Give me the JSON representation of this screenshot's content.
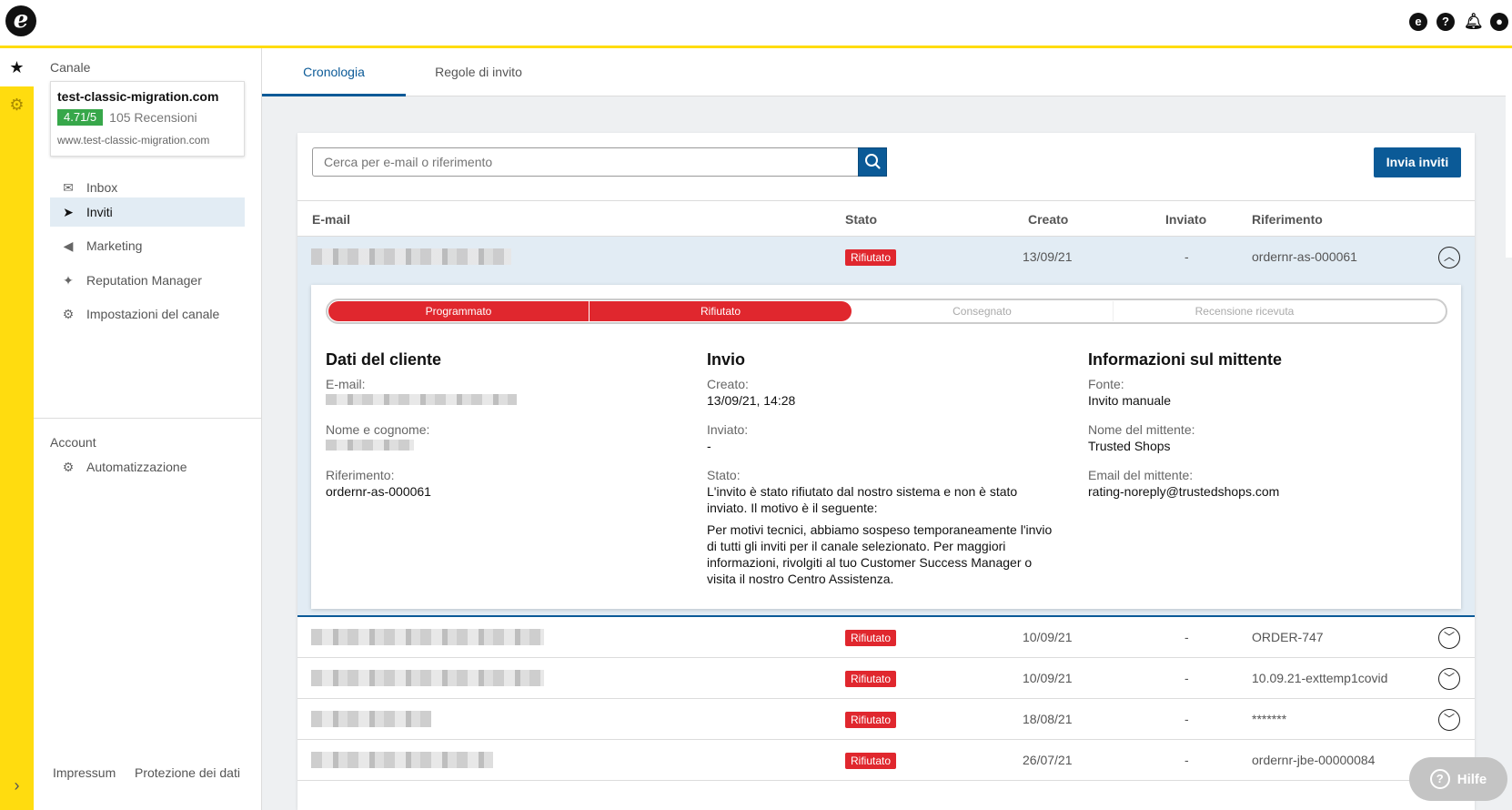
{
  "topbar": {
    "logo_glyph": "e",
    "icons": [
      "etrusted-icon",
      "help-icon",
      "bell-icon",
      "user-icon"
    ]
  },
  "rail": {
    "star": "★",
    "gear": "⚙",
    "chevron": "›"
  },
  "sidebar": {
    "channel_label": "Canale",
    "channel": {
      "name": "test-classic-migration.com",
      "rating": "4.71/5",
      "reviews": "105 Recensioni",
      "url": "www.test-classic-migration.com"
    },
    "items": [
      {
        "label": "Inbox",
        "icon": "inbox-icon",
        "glyph": "✉",
        "active": false
      },
      {
        "label": "Inviti",
        "icon": "paper-plane-icon",
        "glyph": "➤",
        "active": true
      },
      {
        "label": "Marketing",
        "icon": "megaphone-icon",
        "glyph": "◀",
        "active": false
      },
      {
        "label": "Reputation Manager",
        "icon": "sparkle-icon",
        "glyph": "✦",
        "active": false
      },
      {
        "label": "Impostazioni del canale",
        "icon": "gear-icon",
        "glyph": "⚙",
        "active": false
      }
    ],
    "account_label": "Account",
    "account_items": [
      {
        "label": "Automatizzazione",
        "icon": "automation-icon",
        "glyph": "⚙"
      }
    ],
    "footer": {
      "impressum": "Impressum",
      "privacy": "Protezione dei dati"
    }
  },
  "tabs": [
    {
      "label": "Cronologia",
      "active": true
    },
    {
      "label": "Regole di invito",
      "active": false
    }
  ],
  "search": {
    "placeholder": "Cerca per e-mail o riferimento"
  },
  "send_button": "Invia inviti",
  "table": {
    "headers": {
      "email": "E-mail",
      "stato": "Stato",
      "creato": "Creato",
      "inviato": "Inviato",
      "riferimento": "Riferimento"
    },
    "rows": [
      {
        "status": "Rifiutato",
        "created": "13/09/21",
        "sent": "-",
        "ref": "ordernr-as-000061",
        "expanded": true
      },
      {
        "status": "Rifiutato",
        "created": "10/09/21",
        "sent": "-",
        "ref": "ORDER-747",
        "expanded": false
      },
      {
        "status": "Rifiutato",
        "created": "10/09/21",
        "sent": "-",
        "ref": "10.09.21-exttemp1covid",
        "expanded": false
      },
      {
        "status": "Rifiutato",
        "created": "18/08/21",
        "sent": "-",
        "ref": "*******",
        "expanded": false
      },
      {
        "status": "Rifiutato",
        "created": "26/07/21",
        "sent": "-",
        "ref": "ordernr-jbe-00000084",
        "expanded": false
      }
    ]
  },
  "detail": {
    "steps": [
      {
        "label": "Programmato",
        "done": true
      },
      {
        "label": "Rifiutato",
        "done": true
      },
      {
        "label": "Consegnato",
        "done": false
      },
      {
        "label": "Recensione ricevuta",
        "done": false
      }
    ],
    "customer": {
      "title": "Dati del cliente",
      "email_label": "E-mail:",
      "name_label": "Nome e cognome:",
      "ref_label": "Riferimento:",
      "ref_value": "ordernr-as-000061"
    },
    "invio": {
      "title": "Invio",
      "created_label": "Creato:",
      "created_value": "13/09/21, 14:28",
      "sent_label": "Inviato:",
      "sent_value": "-",
      "state_label": "Stato:",
      "state_line1": "L'invito è stato rifiutato dal nostro sistema e non è stato",
      "state_line2": "inviato. Il motivo è il seguente:",
      "reason_line1": "Per motivi tecnici, abbiamo sospeso temporaneamente l'invio",
      "reason_line2": "di tutti gli inviti per il canale selezionato. Per maggiori",
      "reason_line3": "informazioni, rivolgiti al tuo Customer Success Manager o",
      "reason_line4": "visita il nostro Centro Assistenza."
    },
    "sender": {
      "title": "Informazioni sul mittente",
      "source_label": "Fonte:",
      "source_value": "Invito manuale",
      "name_label": "Nome del mittente:",
      "name_value": "Trusted Shops",
      "email_label": "Email del mittente:",
      "email_value": "rating-noreply@trustedshops.com"
    }
  },
  "help": {
    "label": "Hilfe",
    "glyph": "?"
  },
  "colors": {
    "accent": "#0b5a97",
    "rail": "#ffdc0f",
    "status_red": "#e0272e",
    "rating_green": "#37a74a"
  }
}
